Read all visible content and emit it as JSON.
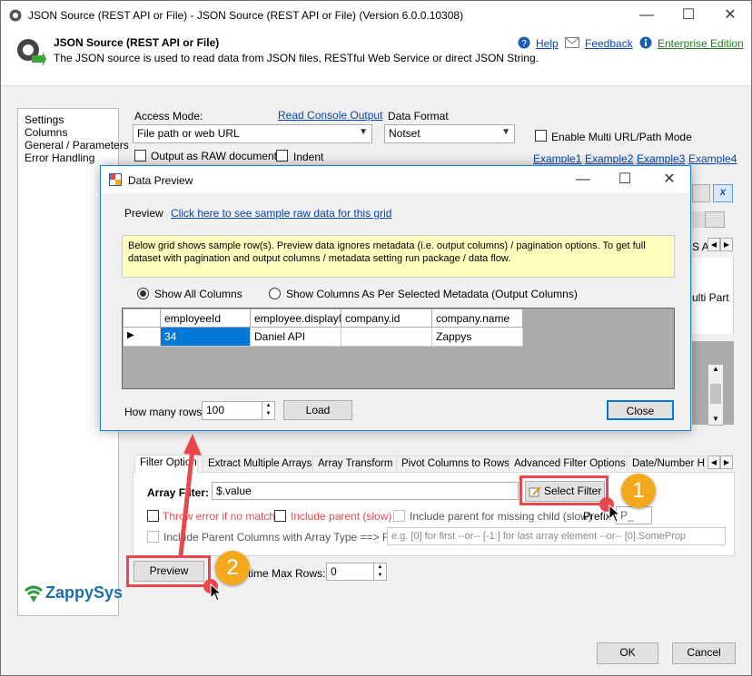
{
  "window": {
    "title": "JSON Source (REST API or File) - JSON Source (REST API or File) (Version 6.0.0.10308)"
  },
  "header": {
    "title": "JSON Source (REST API or File)",
    "description": "The JSON source is used to read data from JSON files, RESTful Web Service or direct JSON String.",
    "help_label": "Help",
    "feedback_label": "Feedback",
    "edition_label": "Enterprise Edition"
  },
  "sidebar": {
    "items": [
      {
        "label": "Settings"
      },
      {
        "label": "Columns"
      },
      {
        "label": "General / Parameters"
      },
      {
        "label": "Error Handling"
      }
    ]
  },
  "settings": {
    "access_mode_label": "Access Mode:",
    "access_mode_value": "File path or web URL",
    "read_console_label": "Read Console Output",
    "data_format_label": "Data Format",
    "data_format_value": "Notset",
    "multi_url_label": "Enable Multi URL/Path Mode",
    "output_raw_label": "Output as RAW document",
    "indent_label": "Indent",
    "examples": [
      "Example1",
      "Example2",
      "Example3",
      "Example4"
    ],
    "partial_right_text_1": "S A",
    "partial_right_text_2": "ulti Part"
  },
  "dialog": {
    "title": "Data Preview",
    "preview_label": "Preview",
    "sample_link": "Click here to see sample raw data for this grid",
    "info_text": "Below grid shows sample row(s). Preview data ignores metadata (i.e. output columns) / pagination options. To get full dataset with pagination and output columns / metadata setting run package / data flow.",
    "radio_all": "Show All Columns",
    "radio_selected": "Show Columns As Per Selected Metadata (Output Columns)",
    "columns": [
      "employeeId",
      "employee.displayNa",
      "company.id",
      "company.name"
    ],
    "row": [
      "34",
      "Daniel API",
      "",
      "Zappys"
    ],
    "rows_label": "How many rows",
    "rows_value": "100",
    "load_label": "Load",
    "close_label": "Close"
  },
  "filter": {
    "tabs": [
      "Filter Options",
      "Extract Multiple Arrays",
      "Array Transform",
      "Pivot Columns to Rows",
      "Advanced Filter Options",
      "Date/Number Ha"
    ],
    "array_filter_label": "Array Filter:",
    "array_filter_value": "$.value",
    "select_filter_label": "Select Filter",
    "throw_error_label": "Throw error if no match",
    "include_parent_label": "Include parent (slow)",
    "include_parent_missing_label": "Include parent for missing child (slow)",
    "prefix_label": "Prefix",
    "prefix_value": "P_",
    "include_parent_cols_label": "Include Parent Columns with Array Type ==> Filter :",
    "filter_placeholder": "e.g. [0] for first --or-- [-1:] for last array element --or-- [0].SomeProp"
  },
  "bottom": {
    "preview_label": "Preview",
    "max_rows_label": "time Max Rows:",
    "max_rows_value": "0",
    "logo_text": "ZappySys",
    "ok_label": "OK",
    "cancel_label": "Cancel"
  },
  "annotations": {
    "badge1": "1",
    "badge2": "2",
    "accent_color": "#e8474d",
    "badge_color": "#f4a81c"
  }
}
